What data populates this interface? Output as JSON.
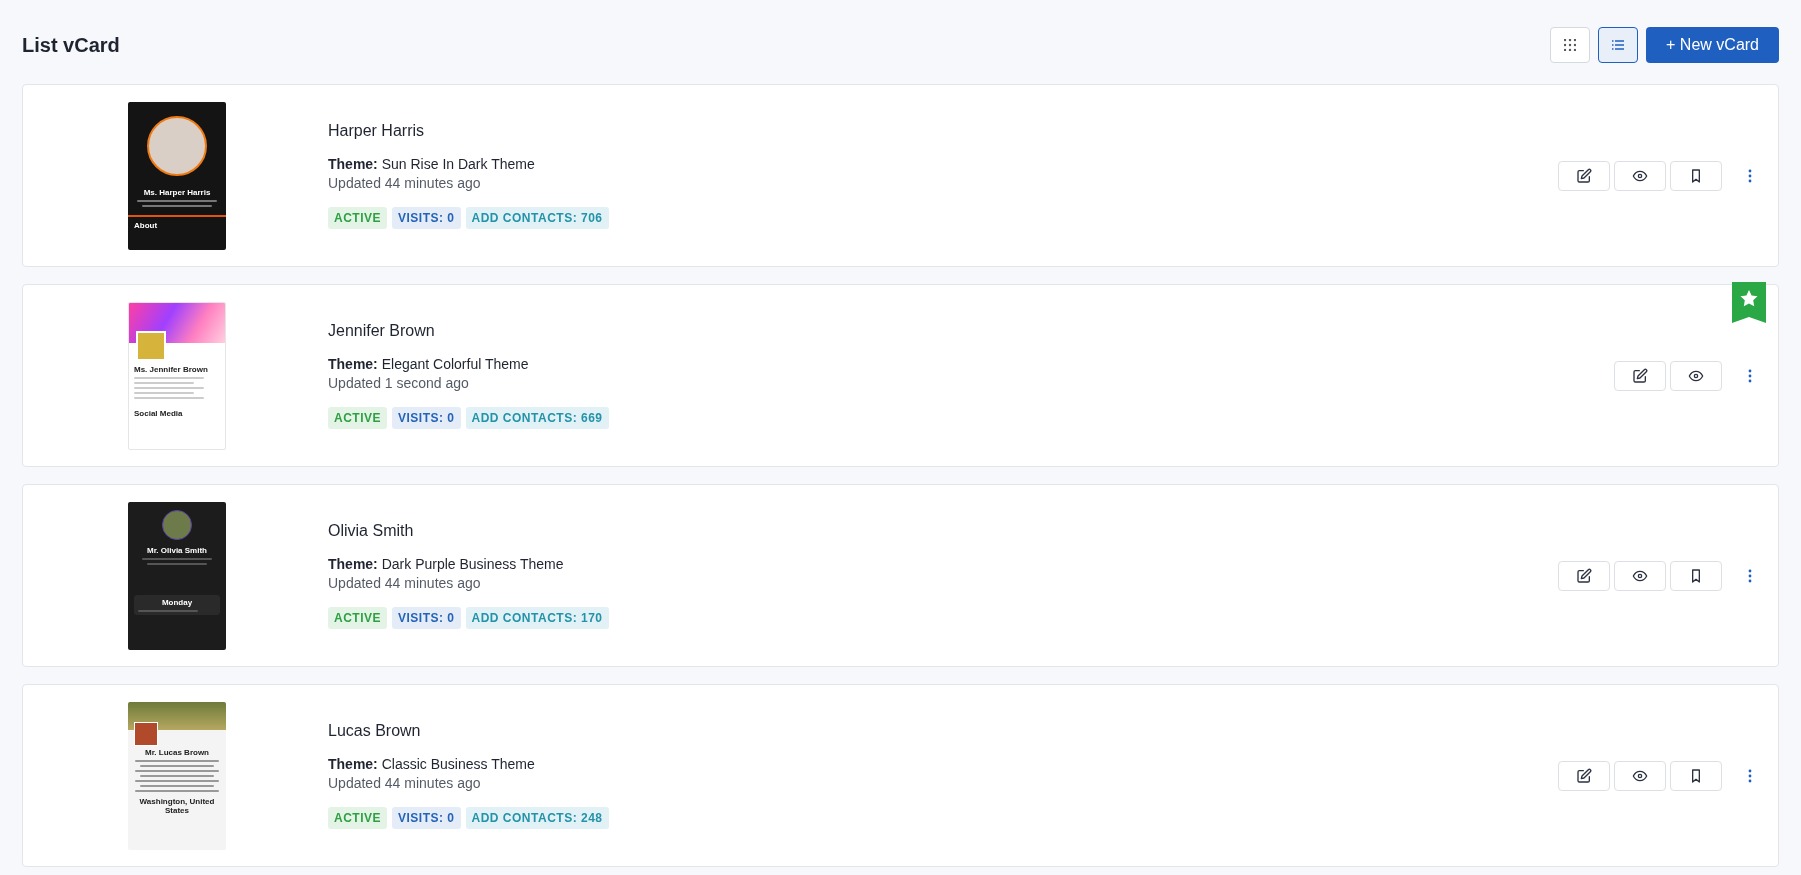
{
  "title": "List vCard",
  "view_toggle": [
    {
      "kind": "grid",
      "selected": false
    },
    {
      "kind": "list",
      "selected": true
    }
  ],
  "new_button": "+ New vCard",
  "vcards": [
    {
      "name": "Harper Harris",
      "theme_label": "Theme:",
      "theme": "Sun Rise In Dark Theme",
      "updated": "Updated 44 minutes ago",
      "featured": false,
      "badges": [
        {
          "kind": "status",
          "text": "ACTIVE"
        },
        {
          "kind": "visits",
          "text": "VISITS: 0"
        },
        {
          "kind": "contacts",
          "text": "ADD CONTACTS: 706"
        }
      ],
      "preview": {
        "kind": "sunrise",
        "name": "Ms. Harper Harris",
        "section": "About"
      }
    },
    {
      "name": "Jennifer Brown",
      "theme_label": "Theme:",
      "theme": "Elegant Colorful Theme",
      "updated": "Updated 1 second ago",
      "featured": true,
      "badges": [
        {
          "kind": "status",
          "text": "ACTIVE"
        },
        {
          "kind": "visits",
          "text": "VISITS: 0"
        },
        {
          "kind": "contacts",
          "text": "ADD CONTACTS: 669"
        }
      ],
      "preview": {
        "kind": "colorful",
        "name": "Ms. Jennifer Brown",
        "section": "Social Media"
      }
    },
    {
      "name": "Olivia Smith",
      "theme_label": "Theme:",
      "theme": "Dark Purple Business Theme",
      "updated": "Updated 44 minutes ago",
      "featured": false,
      "badges": [
        {
          "kind": "status",
          "text": "ACTIVE"
        },
        {
          "kind": "visits",
          "text": "VISITS: 0"
        },
        {
          "kind": "contacts",
          "text": "ADD CONTACTS: 170"
        }
      ],
      "preview": {
        "kind": "darkpurple",
        "name": "Mr. Olivia Smith",
        "section": "Monday"
      }
    },
    {
      "name": "Lucas Brown",
      "theme_label": "Theme:",
      "theme": "Classic Business Theme",
      "updated": "Updated 44 minutes ago",
      "featured": false,
      "badges": [
        {
          "kind": "status",
          "text": "ACTIVE"
        },
        {
          "kind": "visits",
          "text": "VISITS: 0"
        },
        {
          "kind": "contacts",
          "text": "ADD CONTACTS: 248"
        }
      ],
      "preview": {
        "kind": "classic",
        "name": "Mr. Lucas Brown",
        "section": "Washington, United States"
      }
    }
  ]
}
